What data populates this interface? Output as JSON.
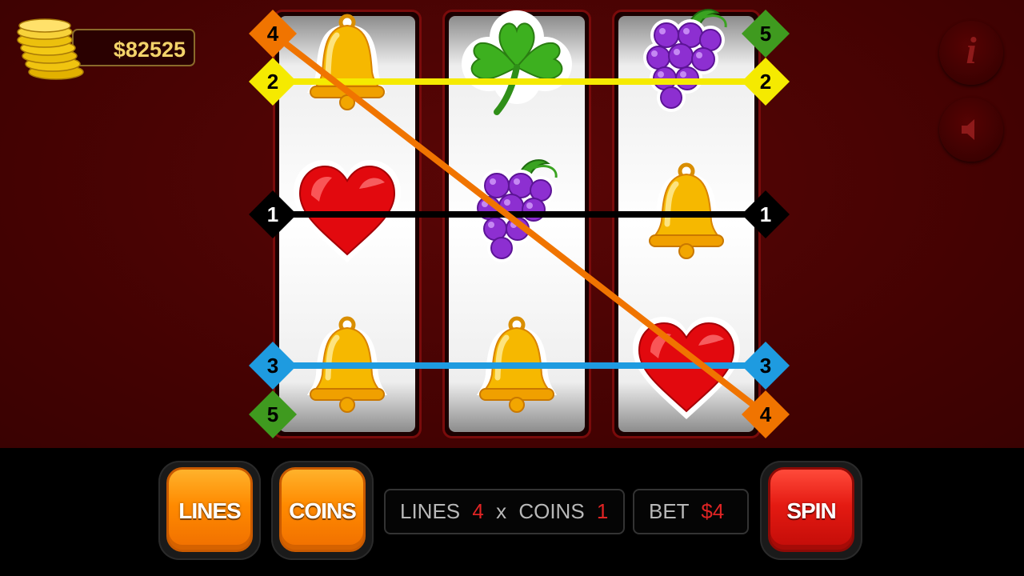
{
  "balance": {
    "amount": "$82525"
  },
  "reels": [
    {
      "symbols": [
        "bell",
        "heart",
        "bell"
      ]
    },
    {
      "symbols": [
        "clover",
        "grapes",
        "bell"
      ]
    },
    {
      "symbols": [
        "grapes",
        "bell",
        "heart"
      ]
    }
  ],
  "paylines": [
    {
      "number": "1",
      "color": "#000000"
    },
    {
      "number": "2",
      "color": "#f5ea00"
    },
    {
      "number": "3",
      "color": "#1e9be0"
    },
    {
      "number": "4",
      "color": "#f07400"
    },
    {
      "number": "5",
      "color": "#3f9a1f"
    }
  ],
  "side_buttons": {
    "info_icon": "info-icon",
    "sound_icon": "speaker-mute-icon",
    "info_glyph": "i"
  },
  "controls": {
    "lines_button": "LINES",
    "coins_button": "COINS",
    "spin_button": "SPIN",
    "lines_label": "LINES",
    "lines_value": "4",
    "times": "x",
    "coins_label": "COINS",
    "coins_value": "1",
    "bet_label": "BET",
    "bet_value": "$4"
  },
  "colors": {
    "background": "#4a0303",
    "accent_gold": "#f3d36a",
    "value_red": "#e02424"
  }
}
